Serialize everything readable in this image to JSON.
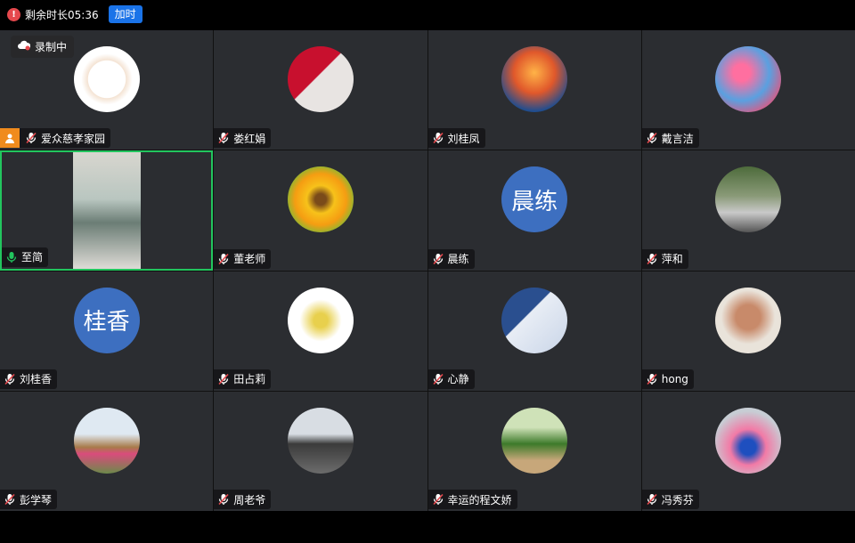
{
  "top": {
    "timer": "剩余时长05:36",
    "extend_button": "加时"
  },
  "recording_label": "录制中",
  "participants": [
    {
      "name": "爱众慈孝家园",
      "avatar": "logo",
      "mic": "muted",
      "host": true
    },
    {
      "name": "娄红娟",
      "avatar": "photo-red",
      "mic": "muted"
    },
    {
      "name": "刘桂凤",
      "avatar": "phoenix",
      "mic": "muted"
    },
    {
      "name": "戴言洁",
      "avatar": "blossom",
      "mic": "muted"
    },
    {
      "name": "至简",
      "avatar": "video",
      "mic": "active"
    },
    {
      "name": "董老师",
      "avatar": "sunflower",
      "mic": "muted"
    },
    {
      "name": "晨练",
      "avatar": "text",
      "avatar_text": "晨练",
      "mic": "muted"
    },
    {
      "name": "萍和",
      "avatar": "person",
      "mic": "muted"
    },
    {
      "name": "刘桂香",
      "avatar": "text",
      "avatar_text": "桂香",
      "mic": "muted"
    },
    {
      "name": "田占莉",
      "avatar": "drawing",
      "mic": "muted"
    },
    {
      "name": "心静",
      "avatar": "room",
      "mic": "muted"
    },
    {
      "name": "hong",
      "avatar": "portrait",
      "mic": "muted"
    },
    {
      "name": "彭学琴",
      "avatar": "outdoor",
      "mic": "muted"
    },
    {
      "name": "周老爷",
      "avatar": "car",
      "mic": "muted"
    },
    {
      "name": "幸运的程文娇",
      "avatar": "palms",
      "mic": "muted"
    },
    {
      "name": "冯秀芬",
      "avatar": "flowers",
      "mic": "muted"
    }
  ],
  "colors": {
    "tile_bg": "#2b2d31",
    "active_border": "#22c55e",
    "extend": "#1a73e8",
    "text_avatar": "#3d6fc0",
    "host": "#f08b1d"
  }
}
